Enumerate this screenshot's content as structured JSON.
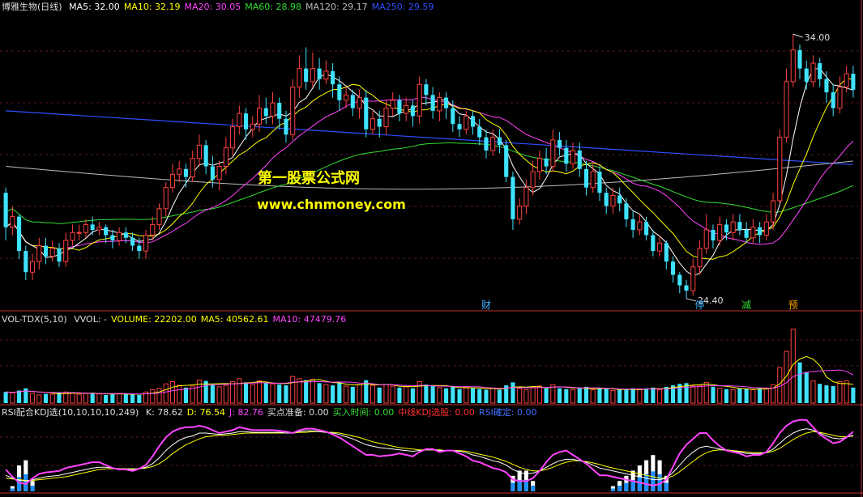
{
  "colors": {
    "up": "#ff4040",
    "down": "#3fe3ff",
    "ma5": "#ffffff",
    "ma10": "#ffff00",
    "ma20": "#ff44ff",
    "ma60": "#33dd33",
    "ma120": "#bbbbbb",
    "ma250": "#2f4fff",
    "frame": "#c03030",
    "grid": "#5a1a1a"
  },
  "main_panel": {
    "stock_name": "博雅生物(日线)",
    "legend": [
      {
        "label": "MA5: 32.00",
        "color": "#ffffff"
      },
      {
        "label": "MA10: 32.19",
        "color": "#ffff00"
      },
      {
        "label": "MA20: 30.05",
        "color": "#ff44ff"
      },
      {
        "label": "MA60: 28.98",
        "color": "#33dd33"
      },
      {
        "label": "MA120: 29.17",
        "color": "#bbbbbb"
      },
      {
        "label": "MA250: 29.59",
        "color": "#2f4fff"
      }
    ],
    "high_label": "34.00",
    "low_label": "24.40",
    "markers": [
      {
        "text": "财",
        "index": 72,
        "color": "#3fb0ff"
      },
      {
        "text": "停",
        "index": 104,
        "color": "#3fb0ff"
      },
      {
        "text": "减",
        "index": 111,
        "color": "#33dd33"
      },
      {
        "text": "预",
        "index": 118,
        "color": "#ffa500"
      }
    ],
    "watermark_title": "第一股票公式网",
    "watermark_url": "www.chnmoney.com"
  },
  "volume_panel": {
    "indicator": "VOL-TDX(5,10)",
    "legend": [
      {
        "label": "VVOL: -",
        "color": "#dddddd"
      },
      {
        "label": "VOLUME: 22202.00",
        "color": "#ffff00"
      },
      {
        "label": "MA5: 40562.61",
        "color": "#ffff00"
      },
      {
        "label": "MA10: 47479.76",
        "color": "#ff44ff"
      }
    ]
  },
  "kdj_panel": {
    "indicator": "RSI配合KDJ选(10,10,10,10,249)",
    "legend": [
      {
        "label": "K: 78.62",
        "color": "#dddddd"
      },
      {
        "label": "D: 76.54",
        "color": "#ffff00"
      },
      {
        "label": "J: 82.76",
        "color": "#ff44ff"
      },
      {
        "label": "买点准备: 0.00",
        "color": "#dddddd"
      },
      {
        "label": "买入时间: 0.00",
        "color": "#33dd33"
      },
      {
        "label": "中线KDJ选股: 0.00",
        "color": "#ff3030"
      },
      {
        "label": "RSI確定: 0.00",
        "color": "#3f6fff"
      }
    ]
  },
  "chart_data": {
    "type": "candlestick",
    "series_count": 128,
    "price_range": [
      24.0,
      35.2
    ],
    "candles": [
      [
        28.4,
        27.1,
        28.6,
        26.6
      ],
      [
        27.1,
        27.5,
        27.9,
        26.8
      ],
      [
        27.5,
        26.2,
        27.6,
        25.9
      ],
      [
        26.2,
        25.4,
        26.4,
        25.1
      ],
      [
        25.4,
        25.8,
        26.1,
        25.1
      ],
      [
        25.8,
        26.4,
        26.7,
        25.5
      ],
      [
        26.4,
        26.0,
        26.7,
        25.7
      ],
      [
        26.0,
        26.3,
        26.6,
        25.8
      ],
      [
        26.3,
        25.8,
        26.5,
        25.6
      ],
      [
        25.8,
        26.6,
        26.9,
        25.6
      ],
      [
        26.6,
        26.9,
        27.2,
        26.4
      ],
      [
        26.9,
        26.9,
        27.2,
        26.6
      ],
      [
        26.9,
        27.2,
        27.4,
        26.7
      ],
      [
        27.2,
        27.0,
        27.5,
        26.8
      ],
      [
        27.0,
        27.1,
        27.3,
        26.8
      ],
      [
        27.1,
        26.8,
        27.2,
        26.5
      ],
      [
        26.8,
        26.6,
        27.0,
        26.3
      ],
      [
        26.6,
        26.9,
        27.1,
        26.4
      ],
      [
        26.9,
        26.7,
        27.1,
        26.5
      ],
      [
        26.7,
        26.4,
        26.9,
        26.2
      ],
      [
        26.4,
        26.2,
        26.7,
        25.9
      ],
      [
        26.2,
        26.8,
        27.0,
        25.9
      ],
      [
        26.8,
        27.2,
        27.5,
        26.6
      ],
      [
        27.2,
        27.8,
        28.0,
        27.0
      ],
      [
        27.8,
        28.6,
        28.8,
        27.5
      ],
      [
        28.6,
        29.1,
        29.5,
        28.4
      ],
      [
        29.1,
        29.3,
        29.6,
        28.8
      ],
      [
        29.3,
        29.0,
        29.5,
        28.6
      ],
      [
        29.0,
        29.7,
        30.0,
        28.8
      ],
      [
        29.7,
        30.2,
        30.6,
        29.4
      ],
      [
        30.2,
        29.4,
        30.4,
        29.1
      ],
      [
        29.4,
        28.9,
        29.8,
        28.6
      ],
      [
        28.9,
        29.4,
        29.6,
        28.5
      ],
      [
        29.4,
        30.1,
        30.5,
        29.1
      ],
      [
        30.1,
        30.9,
        31.2,
        29.8
      ],
      [
        30.9,
        31.4,
        31.7,
        30.6
      ],
      [
        31.4,
        30.8,
        31.6,
        30.4
      ],
      [
        30.8,
        31.0,
        31.3,
        30.5
      ],
      [
        31.0,
        31.6,
        32.1,
        30.7
      ],
      [
        31.6,
        31.3,
        32.0,
        31.0
      ],
      [
        31.3,
        31.8,
        32.2,
        31.0
      ],
      [
        31.8,
        31.2,
        32.0,
        30.8
      ],
      [
        31.2,
        30.6,
        31.5,
        30.3
      ],
      [
        30.6,
        32.4,
        32.7,
        30.4
      ],
      [
        32.4,
        33.1,
        33.6,
        32.0
      ],
      [
        33.1,
        32.6,
        33.9,
        32.3
      ],
      [
        32.6,
        33.1,
        33.7,
        32.4
      ],
      [
        33.1,
        32.7,
        33.5,
        32.3
      ],
      [
        32.7,
        33.0,
        33.4,
        32.5
      ],
      [
        33.0,
        32.5,
        33.3,
        32.0
      ],
      [
        32.5,
        31.9,
        32.8,
        31.5
      ],
      [
        31.9,
        32.1,
        32.4,
        31.6
      ],
      [
        32.1,
        31.6,
        32.3,
        31.3
      ],
      [
        31.6,
        32.0,
        32.3,
        31.2
      ],
      [
        32.0,
        30.8,
        32.3,
        30.5
      ],
      [
        30.8,
        31.2,
        31.5,
        30.6
      ],
      [
        31.2,
        30.9,
        31.5,
        30.5
      ],
      [
        30.9,
        31.6,
        31.9,
        30.6
      ],
      [
        31.6,
        31.9,
        32.2,
        31.3
      ],
      [
        31.9,
        31.4,
        32.1,
        31.1
      ],
      [
        31.4,
        31.7,
        32.0,
        31.1
      ],
      [
        31.7,
        31.3,
        31.9,
        30.9
      ],
      [
        31.3,
        32.5,
        32.8,
        31.0
      ],
      [
        32.5,
        32.1,
        32.7,
        31.7
      ],
      [
        32.1,
        31.5,
        32.4,
        31.2
      ],
      [
        31.5,
        32.0,
        32.2,
        31.1
      ],
      [
        32.0,
        31.6,
        32.2,
        31.2
      ],
      [
        31.6,
        31.0,
        31.9,
        30.7
      ],
      [
        31.0,
        30.8,
        31.3,
        30.5
      ],
      [
        30.8,
        31.3,
        31.5,
        30.6
      ],
      [
        31.3,
        30.9,
        31.5,
        30.6
      ],
      [
        30.9,
        30.5,
        31.2,
        30.2
      ],
      [
        30.5,
        30.0,
        30.8,
        29.7
      ],
      [
        30.0,
        30.5,
        30.8,
        29.8
      ],
      [
        30.5,
        30.2,
        30.8,
        29.9
      ],
      [
        30.2,
        29.0,
        30.4,
        28.8
      ],
      [
        29.0,
        27.4,
        29.2,
        27.0
      ],
      [
        27.4,
        27.9,
        28.2,
        27.2
      ],
      [
        27.9,
        28.6,
        28.9,
        27.6
      ],
      [
        28.6,
        29.2,
        29.6,
        28.3
      ],
      [
        29.2,
        29.7,
        30.0,
        28.9
      ],
      [
        29.7,
        29.4,
        30.1,
        29.1
      ],
      [
        29.4,
        30.4,
        30.8,
        29.2
      ],
      [
        30.4,
        30.1,
        30.7,
        29.8
      ],
      [
        30.1,
        29.5,
        30.4,
        29.2
      ],
      [
        29.5,
        30.0,
        30.3,
        29.3
      ],
      [
        30.0,
        29.3,
        30.3,
        29.0
      ],
      [
        29.3,
        28.6,
        29.6,
        28.3
      ],
      [
        28.6,
        29.2,
        29.5,
        28.4
      ],
      [
        29.2,
        28.4,
        29.4,
        28.1
      ],
      [
        28.4,
        27.9,
        28.6,
        27.6
      ],
      [
        27.9,
        28.3,
        28.6,
        27.6
      ],
      [
        28.3,
        28.0,
        28.6,
        27.7
      ],
      [
        28.0,
        27.4,
        28.2,
        27.1
      ],
      [
        27.4,
        27.0,
        27.7,
        26.7
      ],
      [
        27.0,
        27.3,
        27.6,
        26.8
      ],
      [
        27.3,
        26.8,
        27.5,
        26.6
      ],
      [
        26.8,
        26.2,
        27.0,
        26.0
      ],
      [
        26.2,
        26.5,
        26.8,
        26.0
      ],
      [
        26.5,
        25.8,
        26.6,
        25.5
      ],
      [
        25.8,
        25.3,
        26.0,
        25.0
      ],
      [
        25.3,
        24.9,
        25.4,
        24.6
      ],
      [
        24.9,
        24.7,
        25.1,
        24.4
      ],
      [
        24.7,
        25.6,
        25.9,
        24.5
      ],
      [
        25.6,
        26.3,
        26.6,
        25.3
      ],
      [
        26.3,
        27.0,
        27.6,
        26.1
      ],
      [
        27.0,
        26.6,
        27.2,
        26.3
      ],
      [
        26.6,
        27.2,
        27.5,
        26.4
      ],
      [
        27.2,
        26.9,
        27.4,
        26.6
      ],
      [
        26.9,
        27.3,
        27.6,
        26.6
      ],
      [
        27.3,
        27.0,
        27.6,
        26.8
      ],
      [
        27.0,
        26.7,
        27.3,
        26.5
      ],
      [
        26.7,
        27.1,
        27.4,
        26.5
      ],
      [
        27.1,
        26.8,
        27.3,
        26.5
      ],
      [
        26.8,
        27.3,
        27.6,
        26.6
      ],
      [
        27.3,
        28.1,
        28.4,
        27.0
      ],
      [
        28.1,
        30.5,
        30.8,
        28.0
      ],
      [
        30.5,
        32.6,
        33.1,
        30.3
      ],
      [
        32.6,
        33.8,
        34.4,
        32.4
      ],
      [
        33.8,
        33.1,
        34.0,
        32.7
      ],
      [
        33.1,
        32.6,
        33.4,
        32.3
      ],
      [
        32.6,
        33.3,
        33.6,
        32.4
      ],
      [
        33.3,
        32.7,
        33.5,
        32.4
      ],
      [
        32.7,
        32.2,
        33.0,
        31.8
      ],
      [
        32.2,
        31.6,
        32.5,
        31.3
      ],
      [
        31.6,
        32.4,
        32.8,
        31.4
      ],
      [
        32.4,
        32.9,
        33.2,
        32.2
      ],
      [
        32.9,
        32.3,
        33.2,
        32.0
      ]
    ],
    "volume": [
      30,
      28,
      34,
      40,
      26,
      22,
      25,
      24,
      28,
      30,
      27,
      24,
      26,
      28,
      25,
      22,
      24,
      26,
      25,
      23,
      22,
      30,
      36,
      40,
      52,
      58,
      48,
      42,
      46,
      62,
      60,
      50,
      44,
      48,
      58,
      66,
      56,
      50,
      60,
      54,
      52,
      50,
      48,
      72,
      66,
      62,
      64,
      54,
      50,
      48,
      58,
      46,
      44,
      50,
      62,
      48,
      42,
      50,
      46,
      42,
      44,
      40,
      58,
      50,
      46,
      42,
      40,
      44,
      38,
      44,
      40,
      38,
      36,
      40,
      36,
      48,
      56,
      40,
      36,
      44,
      46,
      40,
      50,
      40,
      38,
      36,
      40,
      44,
      36,
      40,
      38,
      34,
      36,
      38,
      40,
      36,
      40,
      42,
      36,
      44,
      48,
      52,
      54,
      46,
      48,
      56,
      44,
      40,
      38,
      36,
      40,
      38,
      36,
      40,
      38,
      50,
      96,
      140,
      200,
      110,
      84,
      60,
      52,
      48,
      46,
      58,
      60,
      42
    ],
    "kdj": {
      "K": [
        22,
        18,
        15,
        14,
        16,
        18,
        20,
        21,
        22,
        24,
        26,
        28,
        30,
        32,
        33,
        33,
        32,
        31,
        31,
        30,
        31,
        33,
        38,
        46,
        56,
        64,
        70,
        74,
        76,
        80,
        80,
        79,
        78,
        79,
        80,
        82,
        82,
        81,
        81,
        81,
        81,
        81,
        80,
        80,
        82,
        83,
        83,
        82,
        81,
        80,
        78,
        75,
        72,
        68,
        64,
        62,
        60,
        59,
        58,
        57,
        56,
        55,
        56,
        57,
        57,
        56,
        56,
        56,
        55,
        53,
        50,
        48,
        45,
        42,
        40,
        36,
        30,
        26,
        24,
        25,
        28,
        33,
        38,
        42,
        44,
        44,
        42,
        40,
        36,
        32,
        30,
        28,
        26,
        24,
        22,
        20,
        18,
        16,
        16,
        18,
        26,
        36,
        46,
        54,
        60,
        62,
        60,
        58,
        56,
        55,
        54,
        52,
        52,
        52,
        53,
        58,
        66,
        74,
        80,
        84,
        86,
        84,
        80,
        76,
        73,
        72,
        74,
        77
      ],
      "D": [
        18,
        17,
        16,
        15,
        15,
        16,
        17,
        18,
        19,
        20,
        22,
        24,
        26,
        28,
        30,
        31,
        31,
        31,
        31,
        31,
        31,
        32,
        34,
        38,
        44,
        52,
        58,
        64,
        68,
        72,
        75,
        76,
        77,
        77,
        78,
        79,
        80,
        80,
        80,
        80,
        80,
        80,
        80,
        80,
        81,
        81,
        82,
        82,
        81,
        81,
        80,
        78,
        76,
        74,
        71,
        68,
        66,
        64,
        62,
        60,
        59,
        58,
        57,
        57,
        57,
        57,
        56,
        56,
        56,
        55,
        53,
        51,
        49,
        47,
        44,
        41,
        37,
        33,
        30,
        28,
        28,
        30,
        33,
        37,
        40,
        42,
        42,
        41,
        39,
        37,
        34,
        32,
        30,
        28,
        26,
        24,
        22,
        20,
        18,
        18,
        21,
        27,
        34,
        41,
        48,
        53,
        56,
        57,
        57,
        56,
        55,
        54,
        53,
        53,
        53,
        55,
        59,
        65,
        71,
        76,
        80,
        82,
        81,
        79,
        77,
        75,
        75,
        76
      ],
      "J": [
        30,
        20,
        12,
        10,
        18,
        24,
        26,
        27,
        28,
        32,
        34,
        36,
        38,
        40,
        40,
        36,
        32,
        30,
        30,
        28,
        31,
        36,
        48,
        62,
        74,
        82,
        86,
        88,
        88,
        90,
        88,
        84,
        80,
        82,
        84,
        88,
        86,
        84,
        84,
        84,
        84,
        83,
        82,
        80,
        84,
        86,
        86,
        84,
        82,
        78,
        74,
        68,
        62,
        56,
        50,
        50,
        48,
        49,
        50,
        52,
        50,
        48,
        54,
        58,
        58,
        54,
        56,
        56,
        52,
        48,
        42,
        40,
        36,
        32,
        30,
        26,
        16,
        14,
        14,
        18,
        28,
        40,
        50,
        54,
        56,
        50,
        44,
        38,
        30,
        22,
        22,
        20,
        18,
        16,
        14,
        12,
        10,
        8,
        10,
        16,
        34,
        52,
        64,
        72,
        80,
        80,
        70,
        62,
        56,
        54,
        52,
        48,
        50,
        50,
        54,
        66,
        80,
        90,
        96,
        98,
        98,
        88,
        78,
        72,
        66,
        68,
        74,
        82
      ]
    }
  }
}
